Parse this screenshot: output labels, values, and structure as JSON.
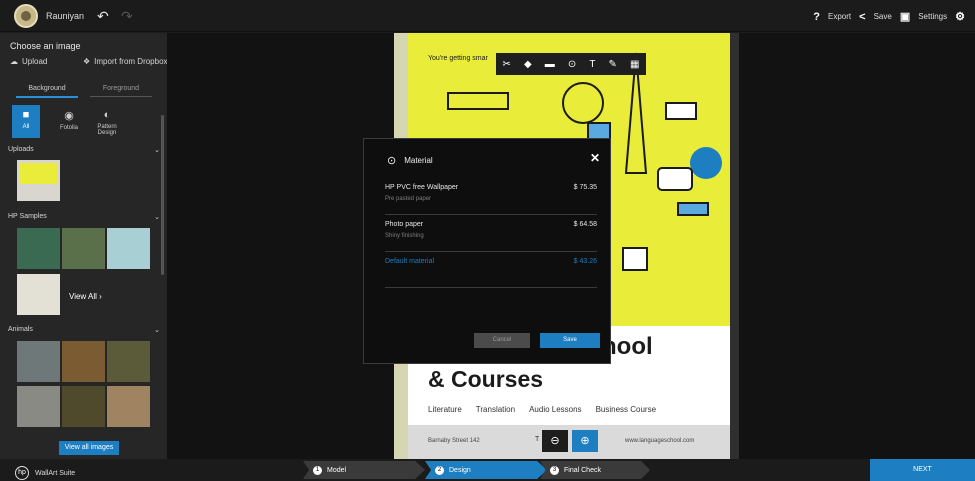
{
  "header": {
    "username": "Rauniyan",
    "help": "?",
    "export_label": "Export",
    "save_label": "Save",
    "settings_label": "Settings"
  },
  "sidebar": {
    "title": "Choose an image",
    "upload_label": "Upload",
    "import_label": "Import from Dropbox",
    "tabs": [
      "Background",
      "Foreground"
    ],
    "sources": [
      {
        "label": "All",
        "icon": "folder-icon"
      },
      {
        "label": "Fotolia",
        "icon": "eye-icon"
      },
      {
        "label": "Pattern Design",
        "icon": "pattern-icon"
      }
    ],
    "sections": {
      "uploads": "Uploads",
      "samples": "HP Samples",
      "animals": "Animals"
    },
    "view_all_link": "View All",
    "view_all_button": "View all images",
    "thumb_colors": [
      "#6aa7c4",
      "#3a6a52",
      "#e3b98a",
      "#d8d6cf",
      "#8a9aa0",
      "#6b4f2e",
      "#59704a",
      "#6f7878",
      "#5b5b3a",
      "#a08462"
    ]
  },
  "document": {
    "tagline": "You're getting smar",
    "headline1": "hool",
    "headline2": "& Courses",
    "courses": [
      "Literature",
      "Translation",
      "Audio Lessons",
      "Business Course"
    ],
    "address": "Barnaby Street 142",
    "website": "www.languageschool.com",
    "zoom_text": "T"
  },
  "modal": {
    "title": "Material",
    "items": [
      {
        "name": "HP PVC free Wallpaper",
        "sub": "Pre pasted paper",
        "price": "$ 75.35"
      },
      {
        "name": "Photo paper",
        "sub": "Shiny finishing",
        "price": "$ 64.58"
      },
      {
        "name": "Default material",
        "sub": "",
        "price": "$ 43.26"
      }
    ],
    "cancel_label": "Cancel",
    "save_label": "Save"
  },
  "footer": {
    "suite": "WallArt Suite",
    "steps": [
      {
        "n": "1",
        "label": "Model"
      },
      {
        "n": "2",
        "label": "Design"
      },
      {
        "n": "3",
        "label": "Final Check"
      }
    ],
    "next_label": "NEXT"
  },
  "colors": {
    "accent": "#1d7ec2",
    "poster_yellow": "#e9ec38"
  }
}
